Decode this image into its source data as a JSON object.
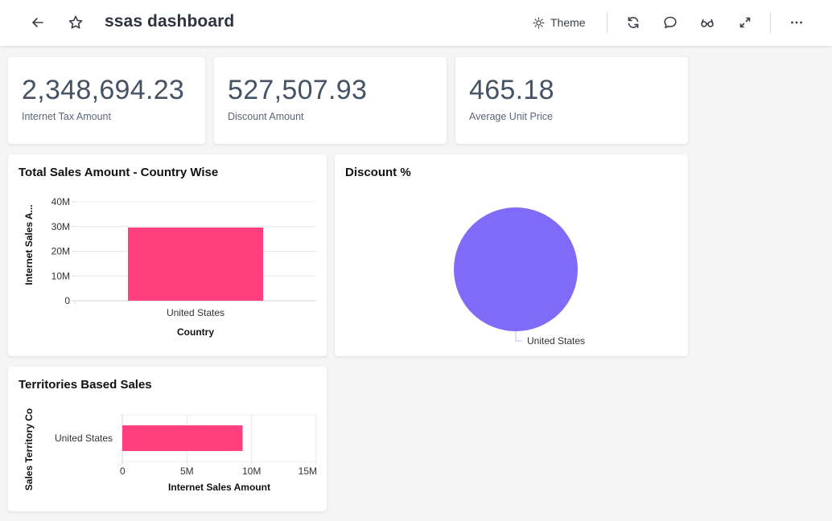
{
  "header": {
    "title": "ssas dashboard",
    "theme_label": "Theme",
    "icons": [
      "back-arrow-icon",
      "star-icon",
      "sun-icon",
      "refresh-icon",
      "comment-icon",
      "glasses-icon",
      "expand-icon",
      "more-icon"
    ]
  },
  "kpis": [
    {
      "value": "2,348,694.23",
      "label": "Internet Tax Amount"
    },
    {
      "value": "527,507.93",
      "label": "Discount Amount"
    },
    {
      "value": "465.18",
      "label": "Average Unit Price"
    }
  ],
  "colors": {
    "bar": "#ff3f7e",
    "pie": "#7f6bf7",
    "kpi_text": "#465364"
  },
  "widgets": {
    "country_chart_title": "Total Sales Amount - Country Wise",
    "discount_chart_title": "Discount %",
    "territory_chart_title": "Territories Based Sales"
  },
  "chart_data": [
    {
      "type": "bar",
      "title": "Total Sales Amount - Country Wise",
      "categories": [
        "United States"
      ],
      "values": [
        29600000
      ],
      "xlabel": "Country",
      "ylabel": "Internet Sales A...",
      "ylim": [
        0,
        40000000
      ],
      "yticks": [
        0,
        10000000,
        20000000,
        30000000,
        40000000
      ],
      "ytick_labels": [
        "0",
        "10M",
        "20M",
        "30M",
        "40M"
      ],
      "grid": true
    },
    {
      "type": "pie",
      "title": "Discount %",
      "categories": [
        "United States"
      ],
      "values": [
        100
      ],
      "labels": [
        "United States"
      ]
    },
    {
      "type": "bar",
      "orientation": "horizontal",
      "title": "Territories Based Sales",
      "categories": [
        "United States"
      ],
      "values": [
        9300000
      ],
      "xlabel": "Internet Sales Amount",
      "ylabel": "Sales Territory Co",
      "xlim": [
        0,
        15000000
      ],
      "xticks": [
        0,
        5000000,
        10000000,
        15000000
      ],
      "xtick_labels": [
        "0",
        "5M",
        "10M",
        "15M"
      ],
      "grid": true
    }
  ]
}
